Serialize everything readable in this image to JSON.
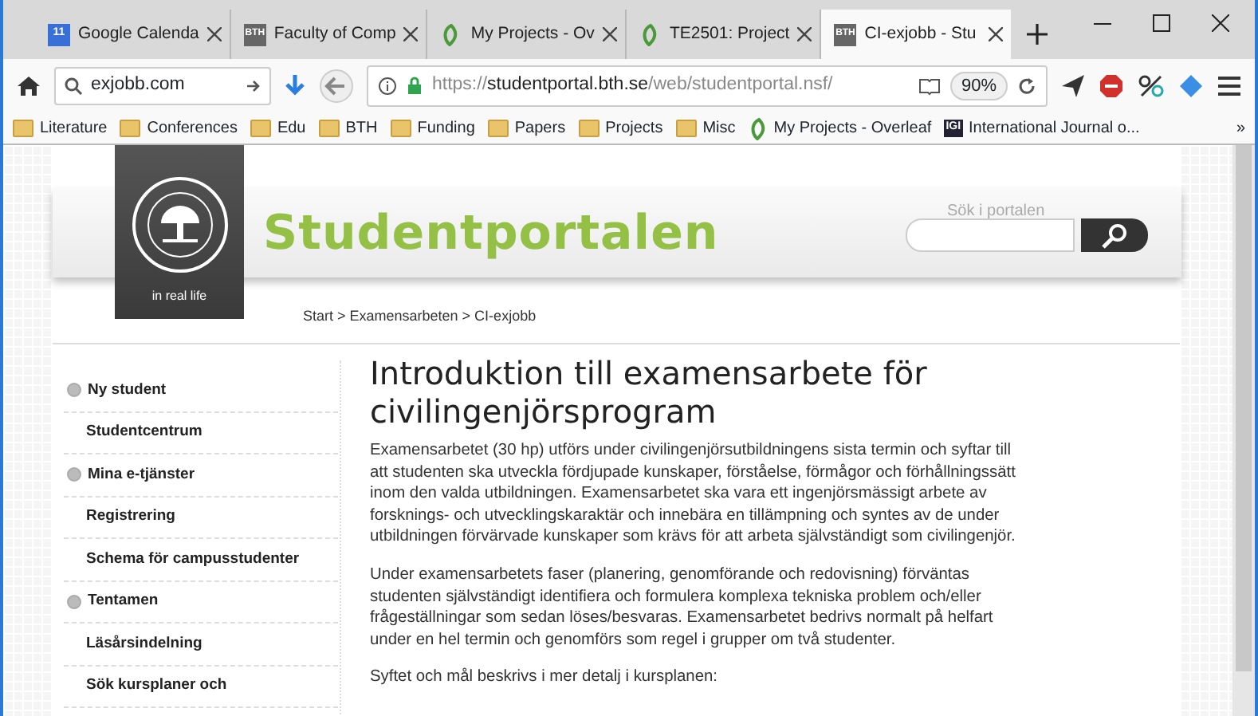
{
  "browser": {
    "tabs": [
      {
        "title": "Google Calenda",
        "kind": "calendar",
        "favicon_text": "11",
        "selected": false
      },
      {
        "title": "Faculty of Comp",
        "kind": "bth",
        "favicon_text": "BTH",
        "selected": false
      },
      {
        "title": "My Projects - Ov",
        "kind": "leaf",
        "selected": false
      },
      {
        "title": "TE2501: Project",
        "kind": "leaf",
        "selected": false
      },
      {
        "title": "CI-exjobb - Stu",
        "kind": "bth",
        "favicon_text": "BTH",
        "selected": true
      }
    ],
    "search_value": "exjobb.com",
    "url": {
      "scheme": "https://",
      "domain": "studentportal.bth.se",
      "path": "/web/studentportal.nsf/"
    },
    "zoom": "90%",
    "bookmarks": [
      {
        "label": "Literature",
        "kind": "folder"
      },
      {
        "label": "Conferences",
        "kind": "folder"
      },
      {
        "label": "Edu",
        "kind": "folder"
      },
      {
        "label": "BTH",
        "kind": "folder"
      },
      {
        "label": "Funding",
        "kind": "folder"
      },
      {
        "label": "Papers",
        "kind": "folder"
      },
      {
        "label": "Projects",
        "kind": "folder"
      },
      {
        "label": "Misc",
        "kind": "folder"
      },
      {
        "label": "My Projects - Overleaf",
        "kind": "leaf"
      },
      {
        "label": "International Journal o...",
        "kind": "igi",
        "icon_text": "IGI"
      }
    ],
    "overflow": "»"
  },
  "page": {
    "logo_tagline": "in real life",
    "site_title": "Studentportalen",
    "search_label": "Sök i portalen",
    "breadcrumb": "Start > Examensarbeten > CI-exjobb",
    "sidebar": [
      {
        "label": "Ny student",
        "kind": "section"
      },
      {
        "label": "Studentcentrum",
        "kind": "link"
      },
      {
        "label": "Mina e-tjänster",
        "kind": "section"
      },
      {
        "label": "Registrering",
        "kind": "link"
      },
      {
        "label": "Schema för campusstudenter",
        "kind": "link"
      },
      {
        "label": "Tentamen",
        "kind": "section"
      },
      {
        "label": "Läsårsindelning",
        "kind": "link"
      },
      {
        "label": "Sök kursplaner och",
        "kind": "link"
      }
    ],
    "heading": "Introduktion till examensarbete för civilingenjörsprogram",
    "paragraphs": [
      "Examensarbetet (30 hp) utförs under civilingenjörsutbildningens sista termin och syftar till att studenten ska utveckla fördjupade kunskaper, förståelse, förmågor och förhållningssätt inom den valda utbildningen. Examensarbetet ska vara ett ingenjörsmässigt arbete av forsknings- och utvecklingskaraktär och innebära en tillämpning och syntes av de under utbildningen förvärvade kunskaper som krävs för att arbeta självständigt som civilingenjör.",
      "Under examensarbetets faser (planering, genomförande och redovisning) förväntas studenten självständigt identifiera och formulera komplexa tekniska problem och/eller frågeställningar som sedan löses/besvaras. Examensarbetet bedrivs normalt på helfart under en hel termin och genomförs som regel i grupper om två studenter.",
      "Syftet och mål beskrivs i mer detalj i kursplanen:"
    ]
  }
}
